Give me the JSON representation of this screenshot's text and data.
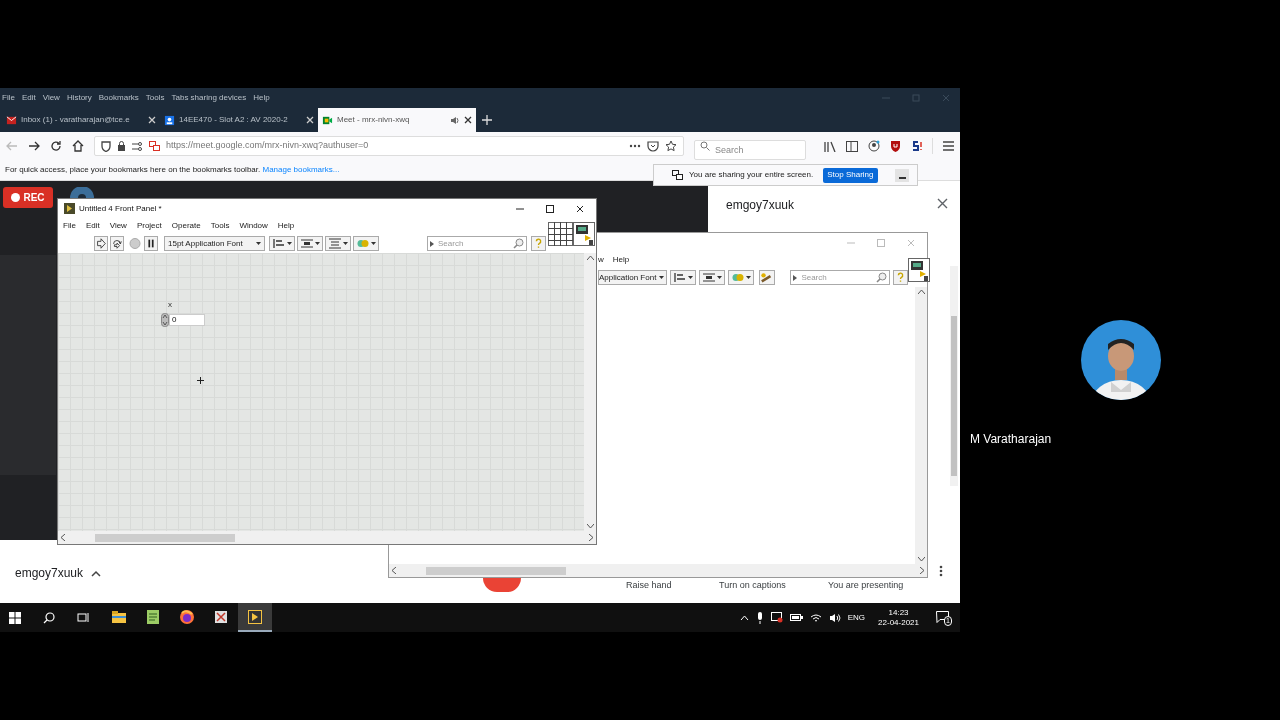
{
  "browser": {
    "menu": [
      "File",
      "Edit",
      "View",
      "History",
      "Bookmarks",
      "Tools",
      "Tabs sharing devices",
      "Help"
    ],
    "tabs": [
      {
        "label": "Inbox (1) - varatharajan@tce.e",
        "kind": "mail",
        "selected": false,
        "audio": false
      },
      {
        "label": "14EE470 - Slot A2 : AV 2020-2",
        "kind": "classroom",
        "selected": false,
        "audio": false
      },
      {
        "label": "Meet - mrx-nivn-xwq",
        "kind": "meet",
        "selected": true,
        "audio": true
      }
    ],
    "url": "https://meet.google.com/mrx-nivn-xwq?authuser=0",
    "search": {
      "placeholder": "Search"
    },
    "bookmarks_hint": {
      "text": "For quick access, place your bookmarks here on the bookmarks toolbar.",
      "link": "Manage bookmarks..."
    }
  },
  "sharing_bar": {
    "message": "You are sharing your entire screen.",
    "button": "Stop Sharing"
  },
  "meet": {
    "rec": "REC",
    "panel_title": "emgoy7xuuk",
    "meeting_code": "emgoy7xuuk",
    "controls": [
      "Raise hand",
      "Turn on captions",
      "You are presenting"
    ]
  },
  "front_panel": {
    "title": "Untitled 4 Front Panel *",
    "menu": [
      "File",
      "Edit",
      "View",
      "Project",
      "Operate",
      "Tools",
      "Window",
      "Help"
    ],
    "font": "15pt Application Font",
    "search": {
      "placeholder": "Search"
    },
    "control": {
      "label": "x",
      "value": "0"
    }
  },
  "back_window": {
    "menu": [
      "w",
      "Help"
    ],
    "font": "Application Font",
    "search": {
      "placeholder": "Search"
    }
  },
  "taskbar": {
    "apps": [
      {
        "kind": "folder",
        "selected": false
      },
      {
        "kind": "notepad",
        "selected": false
      },
      {
        "kind": "browser",
        "selected": false
      },
      {
        "kind": "spreadsheet",
        "selected": false
      },
      {
        "kind": "labview",
        "selected": true
      }
    ],
    "language": "ENG",
    "time": "14:23",
    "date": "22-04-2021",
    "notifications": "1"
  },
  "participant": {
    "name": "M Varatharajan"
  }
}
